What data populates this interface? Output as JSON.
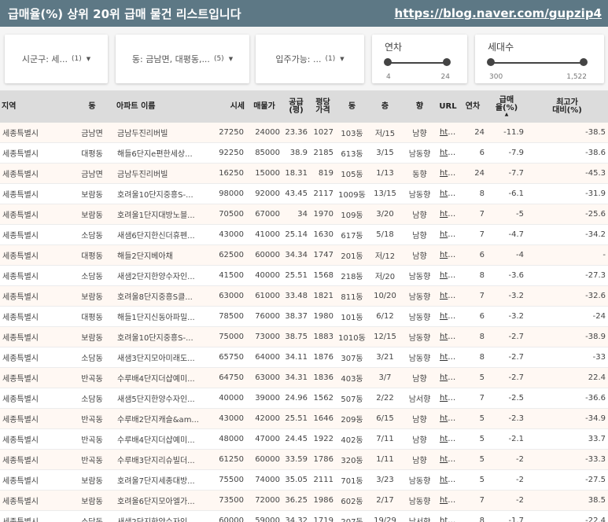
{
  "header": {
    "title": "급매율(%) 상위 20위 급매 물건 리스트입니다",
    "link": "https://blog.naver.com/gupzip4"
  },
  "filters": {
    "sigungu": {
      "label": "시군구: 세...",
      "count": "(1)"
    },
    "dong": {
      "label": "동: 금남면, 대평동,...",
      "count": "(5)"
    },
    "move": {
      "label": "입주가능: ...",
      "count": "(1)"
    },
    "years": {
      "label": "연차",
      "min": "4",
      "max": "24",
      "low_frac": 0,
      "high_frac": 1
    },
    "households": {
      "label": "세대수",
      "min": "300",
      "max": "1,522",
      "low_frac": 0,
      "high_frac": 1
    }
  },
  "table": {
    "columns": [
      {
        "label": "지역"
      },
      {
        "label": "동"
      },
      {
        "label": "아파트 이름"
      },
      {
        "label": "시세"
      },
      {
        "label": "매물가"
      },
      {
        "label": "공급\n(평)"
      },
      {
        "label": "평당\n가격"
      },
      {
        "label": "동"
      },
      {
        "label": "층"
      },
      {
        "label": "향"
      },
      {
        "label": "URL"
      },
      {
        "label": "연차"
      },
      {
        "label": "급매\n율(%)",
        "sort": "▲"
      },
      {
        "label": "최고가\n대비(%)"
      }
    ],
    "rows": [
      [
        "세종특별시",
        "금남면",
        "금남두진리버빌",
        "27250",
        "24000",
        "23.36",
        "1027",
        "103동",
        "저/15",
        "남향",
        "htt...",
        "24",
        "-11.9",
        "-38.5"
      ],
      [
        "세종특별시",
        "대평동",
        "해들6단지e편한세상...",
        "92250",
        "85000",
        "38.9",
        "2185",
        "613동",
        "3/15",
        "남동향",
        "htt...",
        "6",
        "-7.9",
        "-38.6"
      ],
      [
        "세종특별시",
        "금남면",
        "금남두진리버빌",
        "16250",
        "15000",
        "18.31",
        "819",
        "105동",
        "1/13",
        "동향",
        "htt...",
        "24",
        "-7.7",
        "-45.3"
      ],
      [
        "세종특별시",
        "보람동",
        "호려울10단지중흥S-...",
        "98000",
        "92000",
        "43.45",
        "2117",
        "1009동",
        "13/15",
        "남동향",
        "htt...",
        "8",
        "-6.1",
        "-31.9"
      ],
      [
        "세종특별시",
        "보람동",
        "호려울1단지대방노블...",
        "70500",
        "67000",
        "34",
        "1970",
        "109동",
        "3/20",
        "남향",
        "htt...",
        "7",
        "-5",
        "-25.6"
      ],
      [
        "세종특별시",
        "소담동",
        "새샘6단지한신더휴펜...",
        "43000",
        "41000",
        "25.14",
        "1630",
        "617동",
        "5/18",
        "남향",
        "htt...",
        "7",
        "-4.7",
        "-34.2"
      ],
      [
        "세종특별시",
        "대평동",
        "해들2단지베아채",
        "62500",
        "60000",
        "34.34",
        "1747",
        "201동",
        "저/12",
        "남향",
        "htt...",
        "6",
        "-4",
        "-"
      ],
      [
        "세종특별시",
        "소담동",
        "새샘2단지한양수자인...",
        "41500",
        "40000",
        "25.51",
        "1568",
        "218동",
        "저/20",
        "남동향",
        "htt...",
        "8",
        "-3.6",
        "-27.3"
      ],
      [
        "세종특별시",
        "보람동",
        "호려울8단지중흥S클...",
        "63000",
        "61000",
        "33.48",
        "1821",
        "811동",
        "10/20",
        "남동향",
        "htt...",
        "7",
        "-3.2",
        "-32.6"
      ],
      [
        "세종특별시",
        "대평동",
        "해들1단지신동아파밀...",
        "78500",
        "76000",
        "38.37",
        "1980",
        "101동",
        "6/12",
        "남동향",
        "htt...",
        "6",
        "-3.2",
        "-24"
      ],
      [
        "세종특별시",
        "보람동",
        "호려울10단지중흥S-...",
        "75000",
        "73000",
        "38.75",
        "1883",
        "1010동",
        "12/15",
        "남동향",
        "htt...",
        "8",
        "-2.7",
        "-38.9"
      ],
      [
        "세종특별시",
        "소담동",
        "새샘3단지모아미래도...",
        "65750",
        "64000",
        "34.11",
        "1876",
        "307동",
        "3/21",
        "남동향",
        "htt...",
        "8",
        "-2.7",
        "-33"
      ],
      [
        "세종특별시",
        "반곡동",
        "수루배4단지더샵예미...",
        "64750",
        "63000",
        "34.31",
        "1836",
        "403동",
        "3/7",
        "남향",
        "htt...",
        "5",
        "-2.7",
        "22.4"
      ],
      [
        "세종특별시",
        "소담동",
        "새샘5단지한양수자인...",
        "40000",
        "39000",
        "24.96",
        "1562",
        "507동",
        "2/22",
        "남서향",
        "htt...",
        "7",
        "-2.5",
        "-36.6"
      ],
      [
        "세종특별시",
        "반곡동",
        "수루배2단지캐슬&am...",
        "43000",
        "42000",
        "25.51",
        "1646",
        "209동",
        "6/15",
        "남향",
        "htt...",
        "5",
        "-2.3",
        "-34.9"
      ],
      [
        "세종특별시",
        "반곡동",
        "수루배4단지더샵예미...",
        "48000",
        "47000",
        "24.45",
        "1922",
        "402동",
        "7/11",
        "남향",
        "htt...",
        "5",
        "-2.1",
        "33.7"
      ],
      [
        "세종특별시",
        "반곡동",
        "수루배3단지리슈빌더...",
        "61250",
        "60000",
        "33.59",
        "1786",
        "320동",
        "1/11",
        "남향",
        "htt...",
        "5",
        "-2",
        "-33.3"
      ],
      [
        "세종특별시",
        "보람동",
        "호려울7단지세종대방...",
        "75500",
        "74000",
        "35.05",
        "2111",
        "701동",
        "3/23",
        "남동향",
        "htt...",
        "5",
        "-2",
        "-27.5"
      ],
      [
        "세종특별시",
        "보람동",
        "호려울6단지모아엘가...",
        "73500",
        "72000",
        "36.25",
        "1986",
        "602동",
        "2/17",
        "남동향",
        "htt...",
        "7",
        "-2",
        "38.5"
      ],
      [
        "세종특별시",
        "소담동",
        "새샘2단지한양수자인...",
        "60000",
        "59000",
        "34.32",
        "1719",
        "207동",
        "19/29",
        "남서향",
        "htt...",
        "8",
        "-1.7",
        "-22.4"
      ]
    ]
  }
}
